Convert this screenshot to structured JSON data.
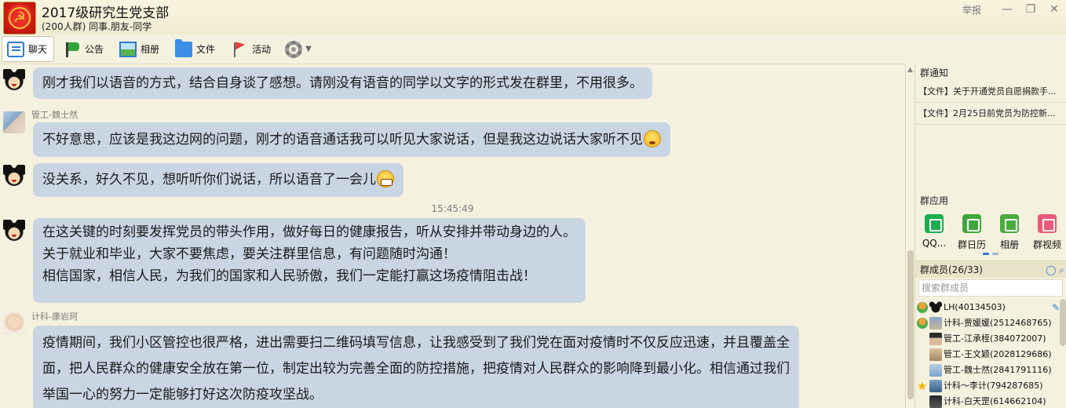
{
  "window": {
    "group_name": "2017级研究生党支部",
    "group_meta": "(200人群) 同事.朋友-同学",
    "report_label": "举报",
    "minimize_label": "—",
    "restore_label": "❐",
    "close_label": "✕"
  },
  "toolbar": {
    "tabs": [
      {
        "label": "聊天",
        "icon": "chat-icon"
      },
      {
        "label": "公告",
        "icon": "flag-icon"
      },
      {
        "label": "相册",
        "icon": "photo-album-icon"
      },
      {
        "label": "文件",
        "icon": "folder-icon"
      },
      {
        "label": "活动",
        "icon": "event-flag-icon"
      }
    ],
    "more_arrow": "▼"
  },
  "chat": {
    "messages": [
      {
        "sender": "",
        "lines": [
          "刚才我们以语音的方式，结合自身谈了感想。请刚没有语音的同学以文字的形式发在群里，不用很多。"
        ]
      },
      {
        "sender": "管工-魏士然",
        "lines": [
          "不好意思，应该是我这边网的问题，刚才的语音通话我可以听见大家说话，但是我这边说话大家听不见"
        ],
        "emoji": "crying-face"
      },
      {
        "sender": "",
        "lines": [
          "没关系，好久不见，想听听你们说话，所以语音了一会儿"
        ],
        "emoji": "grinning-face"
      },
      {
        "sender": "",
        "lines": [
          "在这关键的时刻要发挥党员的带头作用，做好每日的健康报告，听从安排并带动身边的人。",
          "关于就业和毕业，大家不要焦虑，要关注群里信息，有问题随时沟通！",
          "相信国家，相信人民，为我们的国家和人民骄傲，我们一定能打赢这场疫情阻击战！"
        ]
      },
      {
        "sender": "计科-康岩珂",
        "lines": [
          "疫情期间，我们小区管控也很严格，进出需要扫二维码填写信息，让我感受到了我们党在面对疫情时不仅反应迅速，并且覆盖全",
          "面，把人民群众的健康安全放在第一位，制定出较为完善全面的防控措施，把疫情对人民群众的影响降到最小化。相信通过我们",
          "举国一心的努力一定能够打好这次防疫攻坚战。"
        ]
      }
    ],
    "timestamp": "15:45:49"
  },
  "right_panel": {
    "notice_title": "群通知",
    "notices": [
      "【文件】关于开通党员自愿捐款手...",
      "【文件】2月25日前党员为防控新..."
    ],
    "apps_title": "群应用",
    "apps": [
      {
        "label": "QQ...",
        "icon": "phone-icon"
      },
      {
        "label": "群日历",
        "icon": "calendar-icon"
      },
      {
        "label": "相册",
        "icon": "photo-icon"
      },
      {
        "label": "群视频",
        "icon": "video-icon"
      }
    ],
    "members_title": "群成员(26/33)",
    "member_search_placeholder": "搜索群成员",
    "members": [
      {
        "name": "LH(40134503)",
        "badge": "owner"
      },
      {
        "name": "计科-贾媛媛(2512468765)",
        "badge": "admin"
      },
      {
        "name": "管工-江承桎(384072007)",
        "badge": ""
      },
      {
        "name": "管工-王文颖(2028129686)",
        "badge": ""
      },
      {
        "name": "管工-魏士然(2841791116)",
        "badge": ""
      },
      {
        "name": "计科～李计(794287685)",
        "badge": "star"
      },
      {
        "name": "计科-白天罡(614662104)",
        "badge": ""
      }
    ]
  },
  "colors": {
    "background": "#f4f1df",
    "bubble": "#c9d5e3",
    "accent": "#2c7bd3"
  }
}
